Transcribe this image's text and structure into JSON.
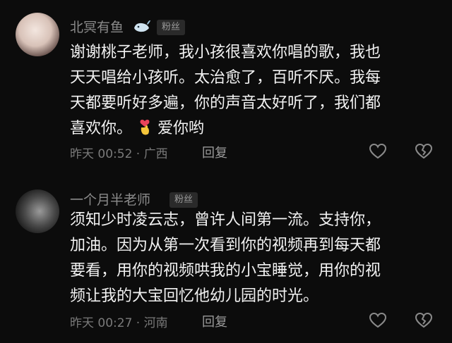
{
  "comments": [
    {
      "username": "北冥有鱼",
      "badge": "粉丝",
      "avatar_icon": "avatar-portrait",
      "user_icon": "whale-icon",
      "text_lines": [
        "谢谢桃子老师，我小孩很喜欢你唱的歌，我也",
        "天天唱给小孩听。太治愈了，百听不厌。我每",
        "天都要听好多遍，你的声音太好听了，我们都"
      ],
      "last_line_prefix": "喜欢你。",
      "last_line_emoji": "finger-heart-icon",
      "last_line_suffix": "爱你哟",
      "meta": "昨天 00:52 · 广西",
      "reply_label": "回复"
    },
    {
      "username": "一个月半老师",
      "badge": "粉丝",
      "avatar_icon": "avatar-portrait",
      "text_lines": [
        "须知少时凌云志，曾许人间第一流。支持你，",
        "加油。因为从第一次看到你的视频再到每天都",
        "要看，用你的视频哄我的小宝睡觉，用你的视",
        "频让我的大宝回忆他幼儿园的时光。"
      ],
      "meta": "昨天 00:27 · 河南",
      "reply_label": "回复"
    }
  ],
  "colors": {
    "background": "#0c0c0c",
    "text": "#f2f2f2",
    "muted": "#7a7a7a",
    "badge_bg": "#2a2a2a"
  }
}
